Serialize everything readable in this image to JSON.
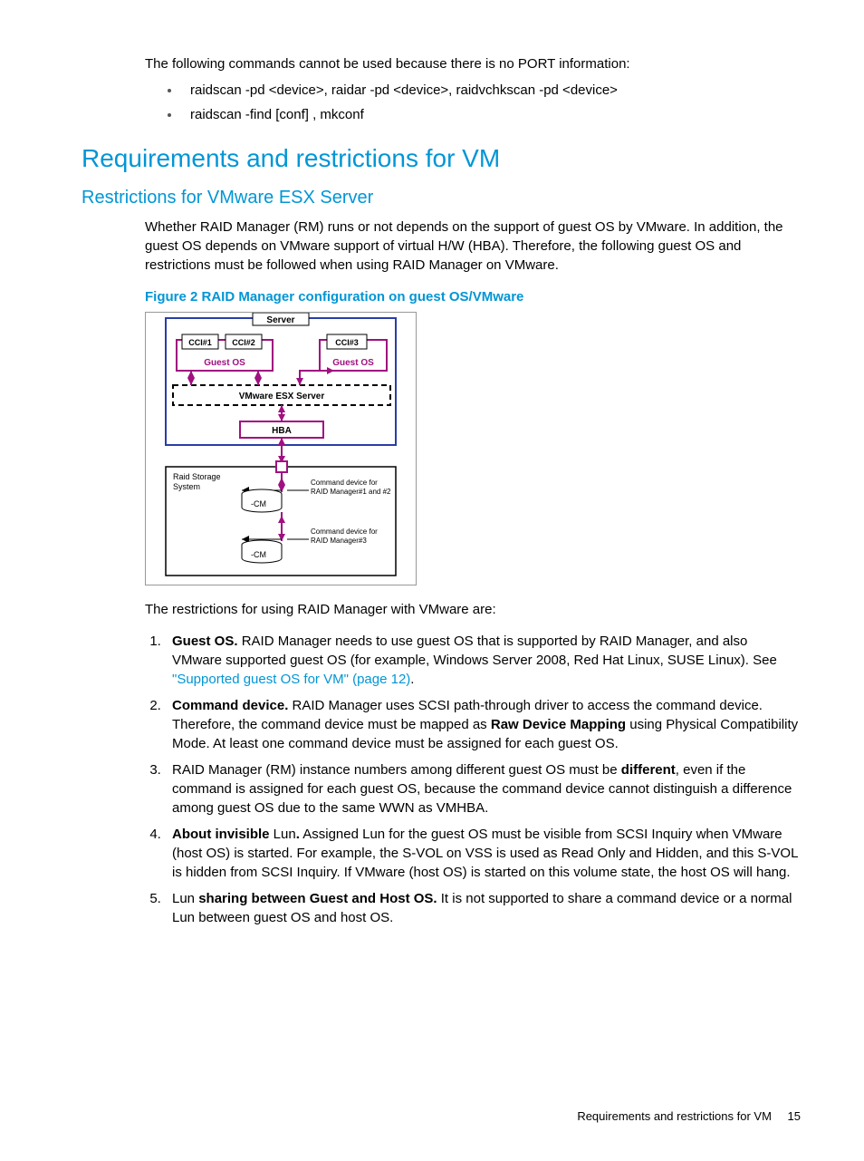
{
  "intro": "The following commands cannot be used because there is no PORT information:",
  "bullets": [
    "raidscan -pd <device>, raidar -pd <device>, raidvchkscan -pd <device>",
    "raidscan -find [conf] , mkconf"
  ],
  "h1": "Requirements and restrictions for VM",
  "h2": "Restrictions for VMware ESX Server",
  "para1": "Whether RAID Manager (RM) runs or not depends on the support of guest OS by VMware. In addition, the guest OS depends on VMware support of virtual H/W (HBA). Therefore, the following guest OS and restrictions must be followed when using RAID Manager on VMware.",
  "figcap": "Figure 2 RAID Manager configuration on guest OS/VMware",
  "figure": {
    "server": "Server",
    "cci1": "CCI#1",
    "cci2": "CCI#2",
    "cci3": "CCI#3",
    "guestos": "Guest OS",
    "vmware": "VMware ESX Server",
    "hba": "HBA",
    "raidstorage1": "Raid Storage",
    "raidstorage2": "System",
    "cmddev1a": "Command device for",
    "cmddev1b": "RAID Manager#1 and #2",
    "cmddev2a": "Command device for",
    "cmddev2b": "RAID Manager#3",
    "cm": "-CM"
  },
  "restrictions_intro": "The restrictions for using RAID Manager with VMware are:",
  "items": {
    "i1": {
      "bold": "Guest OS.",
      "text": " RAID Manager needs to use guest OS that is supported by RAID Manager, and also VMware supported guest OS (for example, Windows Server 2008, Red Hat Linux, SUSE Linux). See ",
      "link": "\"Supported guest OS for VM\" (page 12)",
      "tail": "."
    },
    "i2": {
      "bold": "Command device.",
      "text1": " RAID Manager uses SCSI path-through driver to access the command device. Therefore, the command device must be mapped as ",
      "bold2": "Raw Device Mapping",
      "text2": " using Physical Compatibility Mode. At least one command device must be assigned for each guest OS."
    },
    "i3": {
      "text1": "RAID Manager (RM) instance numbers among different guest OS must be ",
      "bold": "different",
      "text2": ", even if the command is assigned for each guest OS, because the command device cannot distinguish a difference among guest OS due to the same WWN as VMHBA."
    },
    "i4": {
      "bold": "About invisible",
      "text1": " Lun",
      "bold2": ".",
      "text2": " Assigned Lun for the guest OS must be visible from SCSI Inquiry when VMware (host OS) is started. For example, the S-VOL on VSS is used as Read Only and Hidden, and this S-VOL is hidden from SCSI Inquiry. If VMware (host OS) is started on this volume state, the host OS will hang."
    },
    "i5": {
      "text1": "Lun ",
      "bold": "sharing between Guest and Host OS.",
      "text2": " It is not supported to share a command device or a normal Lun between guest OS and host OS."
    }
  },
  "footer": {
    "text": "Requirements and restrictions for VM",
    "page": "15"
  }
}
